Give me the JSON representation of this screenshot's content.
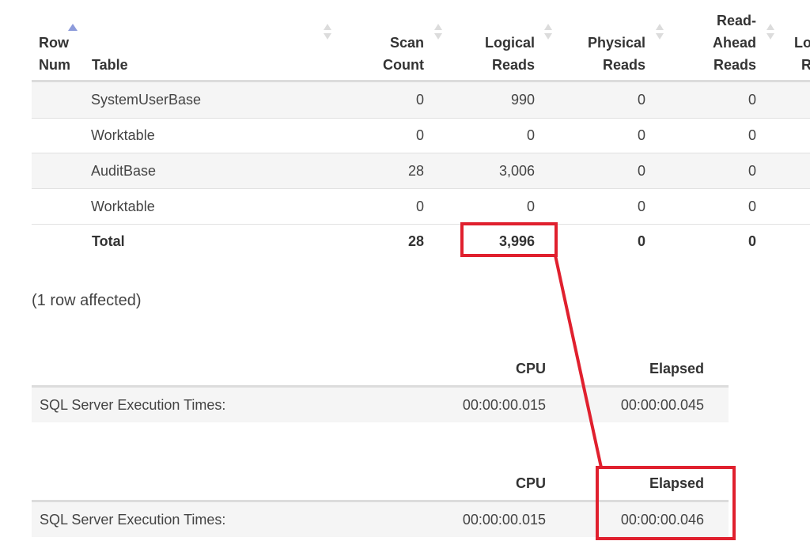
{
  "stats_table": {
    "headers": {
      "row_num_line1": "Row",
      "row_num_line2": "Num",
      "table": "Table",
      "scan_count_line1": "Scan",
      "scan_count_line2": "Count",
      "logical_reads_line1": "Logical",
      "logical_reads_line2": "Reads",
      "physical_reads_line1": "Physical",
      "physical_reads_line2": "Reads",
      "read_ahead_line1": "Read-",
      "read_ahead_line2": "Ahead",
      "read_ahead_line3": "Reads",
      "lob_partial_line1": "Lo",
      "lob_partial_line2": "R"
    },
    "rows": [
      {
        "table": "SystemUserBase",
        "scan_count": "0",
        "logical_reads": "990",
        "physical_reads": "0",
        "read_ahead_reads": "0"
      },
      {
        "table": "Worktable",
        "scan_count": "0",
        "logical_reads": "0",
        "physical_reads": "0",
        "read_ahead_reads": "0"
      },
      {
        "table": "AuditBase",
        "scan_count": "28",
        "logical_reads": "3,006",
        "physical_reads": "0",
        "read_ahead_reads": "0"
      },
      {
        "table": "Worktable",
        "scan_count": "0",
        "logical_reads": "0",
        "physical_reads": "0",
        "read_ahead_reads": "0"
      }
    ],
    "total": {
      "label": "Total",
      "scan_count": "28",
      "logical_reads": "3,996",
      "physical_reads": "0",
      "read_ahead_reads": "0"
    }
  },
  "rows_affected": "(1 row affected)",
  "exec_times": [
    {
      "cpu_header": "CPU",
      "elapsed_header": "Elapsed",
      "label": "SQL Server Execution Times:",
      "cpu": "00:00:00.015",
      "elapsed": "00:00:00.045"
    },
    {
      "cpu_header": "CPU",
      "elapsed_header": "Elapsed",
      "label": "SQL Server Execution Times:",
      "cpu": "00:00:00.015",
      "elapsed": "00:00:00.046"
    }
  ],
  "colors": {
    "annotation": "#e0202e",
    "sort_active": "#8d9bdb",
    "row_shade": "#f5f5f5",
    "border": "#dcdcdc"
  }
}
